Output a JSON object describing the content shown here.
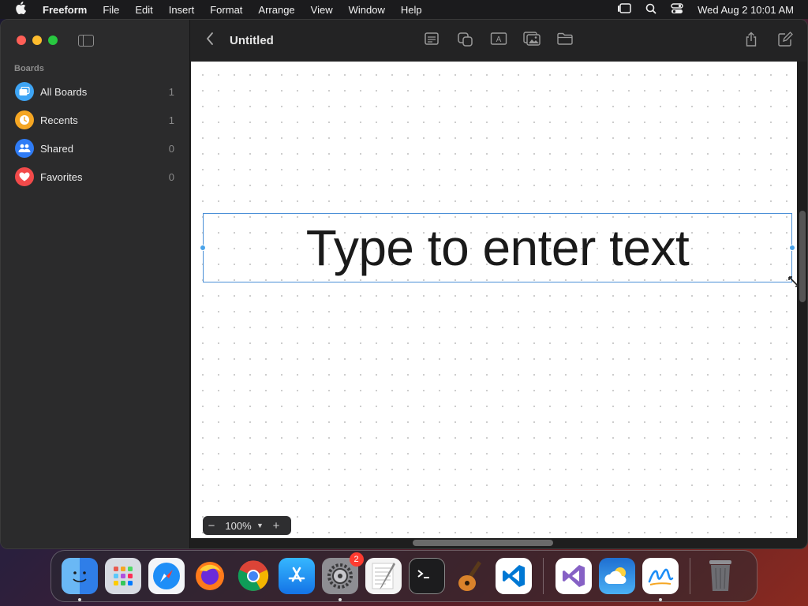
{
  "menubar": {
    "app_name": "Freeform",
    "items": [
      "File",
      "Edit",
      "Insert",
      "Format",
      "Arrange",
      "View",
      "Window",
      "Help"
    ],
    "clock": "Wed Aug 2  10:01 AM"
  },
  "sidebar": {
    "section_title": "Boards",
    "items": [
      {
        "label": "All Boards",
        "count": "1",
        "icon": "boards-icon",
        "color": "#3ea5f5"
      },
      {
        "label": "Recents",
        "count": "1",
        "icon": "clock-icon",
        "color": "#f5a623"
      },
      {
        "label": "Shared",
        "count": "0",
        "icon": "people-icon",
        "color": "#2f7cf6"
      },
      {
        "label": "Favorites",
        "count": "0",
        "icon": "heart-icon",
        "color": "#f24a4a"
      }
    ]
  },
  "toolbar": {
    "title": "Untitled"
  },
  "canvas": {
    "textbox_text": "Type to enter text"
  },
  "zoom": {
    "value": "100%"
  },
  "dock": {
    "apps": [
      {
        "name": "Finder",
        "icon": "finder-icon",
        "color": "#3a8ef0"
      },
      {
        "name": "Launchpad",
        "icon": "launchpad-icon",
        "color": "#cfd3da"
      },
      {
        "name": "Safari",
        "icon": "safari-icon",
        "color": "#2f8ff0"
      },
      {
        "name": "Firefox",
        "icon": "firefox-icon",
        "color": "#ff7a1a"
      },
      {
        "name": "Chrome",
        "icon": "chrome-icon",
        "color": "#ffffff"
      },
      {
        "name": "App Store",
        "icon": "appstore-icon",
        "color": "#1e8ef7"
      },
      {
        "name": "System Settings",
        "icon": "settings-icon",
        "color": "#8e8e93",
        "badge": "2"
      },
      {
        "name": "TextEdit",
        "icon": "textedit-icon",
        "color": "#f2f2f2"
      },
      {
        "name": "Terminal",
        "icon": "terminal-icon",
        "color": "#1a1a1a"
      },
      {
        "name": "GarageBand",
        "icon": "garageband-icon",
        "color": "#3a2a1a"
      },
      {
        "name": "VS Code",
        "icon": "vscode-icon",
        "color": "#ffffff"
      },
      {
        "name": "Visual Studio",
        "icon": "visualstudio-icon",
        "color": "#ffffff"
      },
      {
        "name": "Weather",
        "icon": "weather-icon",
        "color": "#2a8ae6"
      },
      {
        "name": "Freeform",
        "icon": "freeform-icon",
        "color": "#ffffff"
      },
      {
        "name": "Trash",
        "icon": "trash-icon",
        "color": "transparent"
      }
    ]
  }
}
